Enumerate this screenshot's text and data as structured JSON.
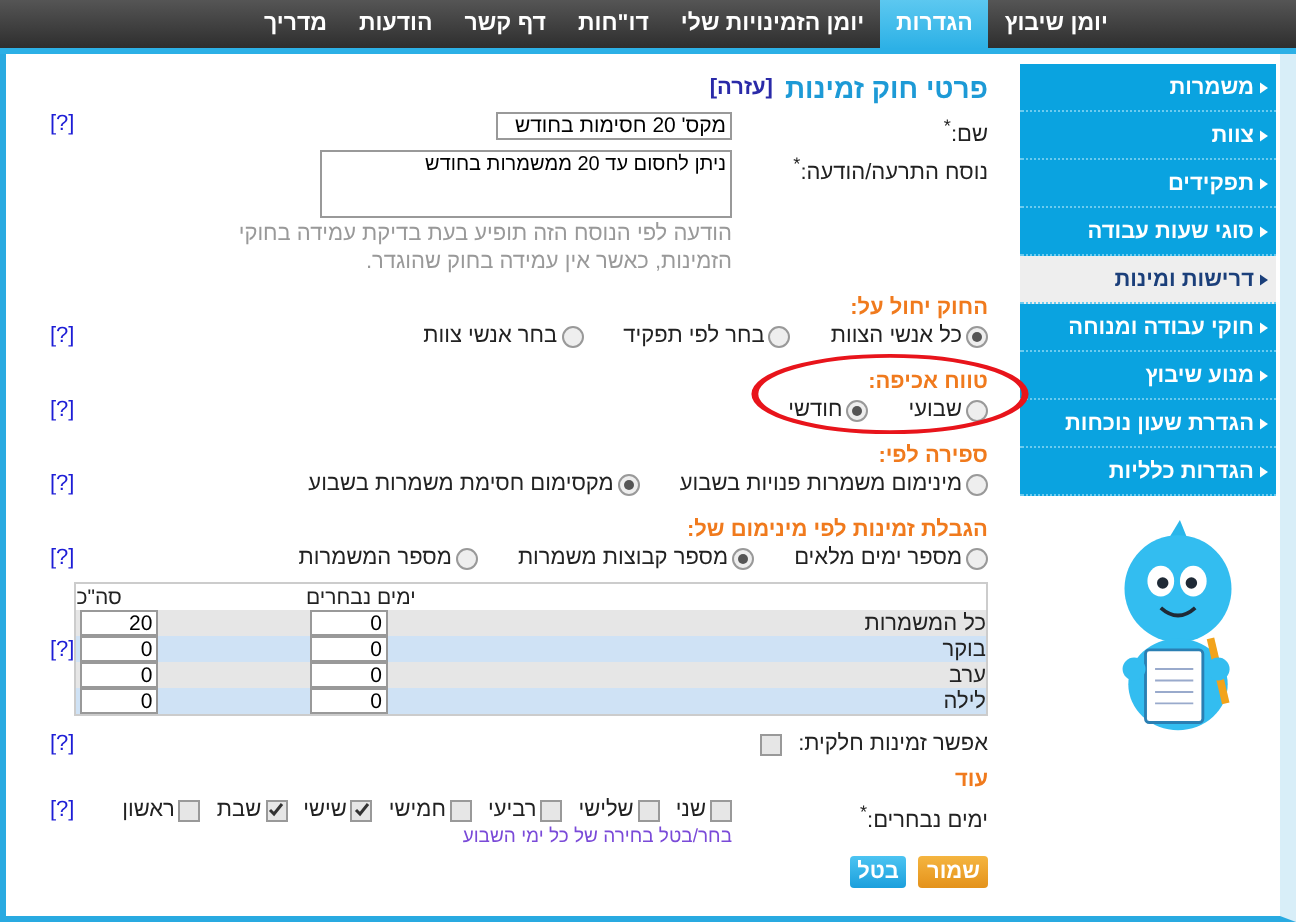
{
  "nav": [
    {
      "label": "יומן שיבוץ",
      "selected": false
    },
    {
      "label": "הגדרות",
      "selected": true
    },
    {
      "label": "יומן הזמינויות שלי",
      "selected": false
    },
    {
      "label": "דו\"חות",
      "selected": false
    },
    {
      "label": "דף קשר",
      "selected": false
    },
    {
      "label": "הודעות",
      "selected": false
    },
    {
      "label": "מדריך",
      "selected": false
    }
  ],
  "sidebar": [
    {
      "label": "משמרות",
      "selected": false
    },
    {
      "label": "צוות",
      "selected": false
    },
    {
      "label": "תפקידים",
      "selected": false
    },
    {
      "label": "סוגי שעות עבודה",
      "selected": false
    },
    {
      "label": "דרישות ומינות",
      "selected": true
    },
    {
      "label": "חוקי עבודה ומנוחה",
      "selected": false
    },
    {
      "label": "מנוע שיבוץ",
      "selected": false
    },
    {
      "label": "הגדרת שעון נוכחות",
      "selected": false
    },
    {
      "label": "הגדרות כלליות",
      "selected": false
    }
  ],
  "form": {
    "title": "פרטי חוק זמינות",
    "help_link": "[עזרה]",
    "name": {
      "label": "שם:$^{*}$",
      "value": "מקס' 20 חסימות בחודש",
      "help": "[?]"
    },
    "message": {
      "label": "נוסח התרעה/הודעה:$^{*}$",
      "value": "ניתן לחסום עד 20 ממשמרות בחודש",
      "hint": "הודעה לפי הנוסח הזה תופיע בעת בדיקת עמידה בחוקי הזמינות, כאשר אין עמידה בחוק שהוגדר."
    },
    "radio_groups": [
      {
        "title": "החוק יחול על:",
        "help": "[?]",
        "options": [
          {
            "label": "כל אנשי הצוות",
            "selected": true
          },
          {
            "label": "בחר לפי תפקיד",
            "selected": false
          },
          {
            "label": "בחר אנשי צוות",
            "selected": false
          }
        ]
      },
      {
        "title": "טווח אכיפה:",
        "help": "[?]",
        "options": [
          {
            "label": "שבועי",
            "selected": false
          },
          {
            "label": "חודשי",
            "selected": true
          }
        ]
      },
      {
        "title": "ספירה לפי:",
        "help": "[?]",
        "options": [
          {
            "label": "מינימום משמרות פנויות בשבוע",
            "selected": false
          },
          {
            "label": "מקסימום חסימת משמרות בשבוע",
            "selected": true
          }
        ]
      },
      {
        "title": "הגבלת זמינות לפי מינימום של:",
        "help": "[?]",
        "options": [
          {
            "label": "מספר ימים מלאים",
            "selected": false
          },
          {
            "label": "מספר קבוצות משמרות",
            "selected": true
          },
          {
            "label": "מספר המשמרות",
            "selected": false
          }
        ]
      }
    ],
    "table": {
      "columns": [
        "ימים נבחרים",
        "סה\"כ"
      ],
      "help": "[?]",
      "rows": [
        {
          "label": "כל המשמרות",
          "values": [
            "0",
            "20"
          ]
        },
        {
          "label": "בוקר",
          "values": [
            "0",
            "0"
          ]
        },
        {
          "label": "ערב",
          "values": [
            "0",
            "0"
          ]
        },
        {
          "label": "לילה",
          "values": [
            "0",
            "0"
          ]
        }
      ]
    },
    "partial": {
      "label": "אפשר זמינות חלקית:",
      "checked": false,
      "help": "[?]"
    },
    "more_title": "עוד",
    "days": {
      "label": "ימים נבחרים:$^{*}$",
      "help": "[?]",
      "toggle_link": "בחר/בטל בחירה של כל ימי השבוע",
      "items": [
        {
          "label": "שני",
          "checked": false
        },
        {
          "label": "שלישי",
          "checked": false
        },
        {
          "label": "רביעי",
          "checked": false
        },
        {
          "label": "חמישי",
          "checked": false
        },
        {
          "label": "שישי",
          "checked": true
        },
        {
          "label": "שבת",
          "checked": true
        },
        {
          "label": "ראשון",
          "checked": false
        }
      ]
    },
    "buttons": [
      {
        "label": "שמור",
        "kind": "primary"
      },
      {
        "label": "בטל",
        "kind": "secondary"
      }
    ]
  }
}
